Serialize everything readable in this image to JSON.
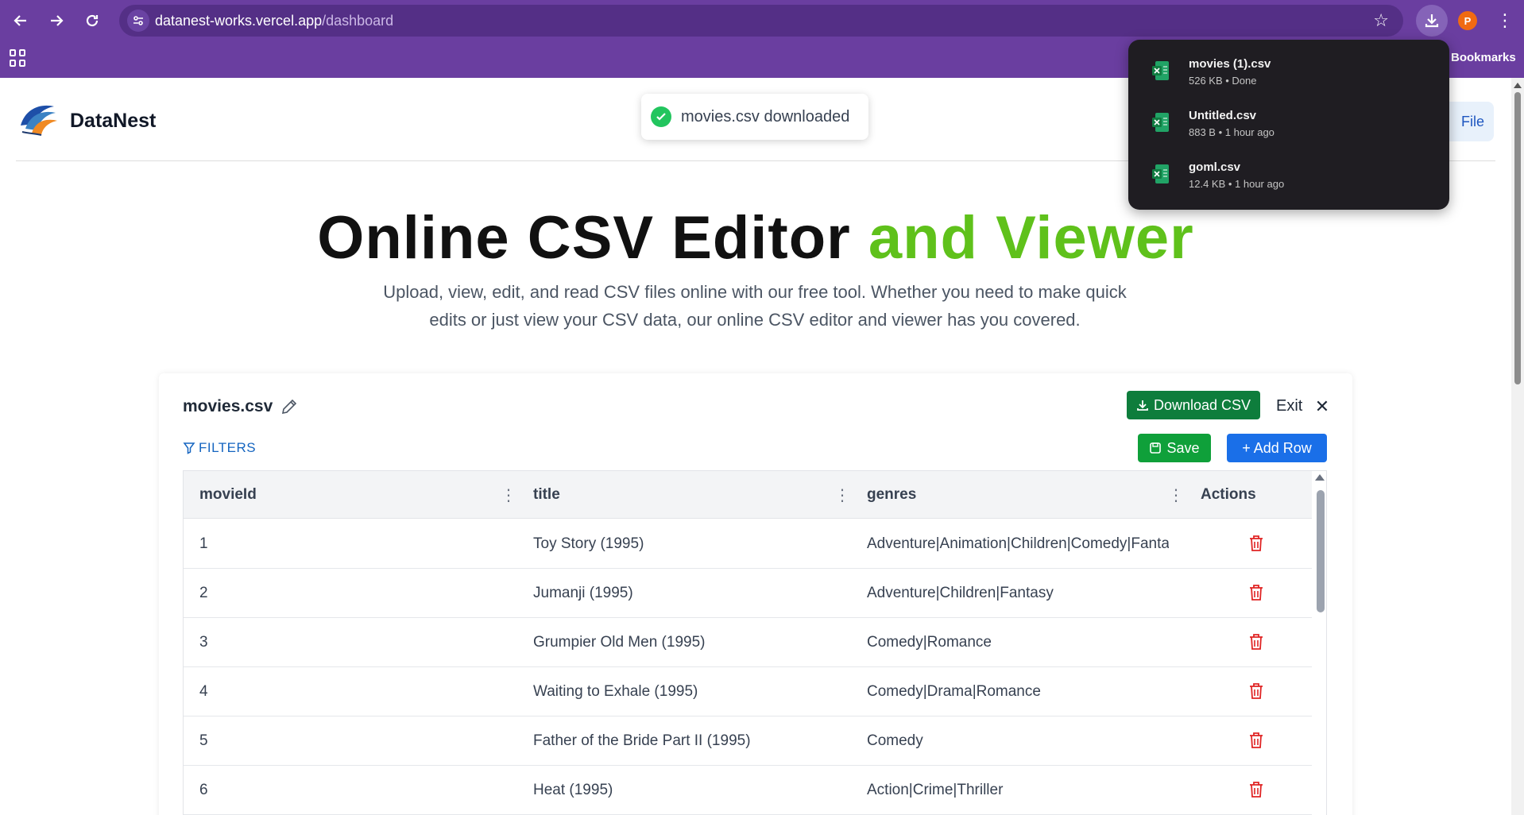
{
  "browser": {
    "url_host": "datanest-works.vercel.app",
    "url_path": "/dashboard",
    "bookmarks_label": "Bookmarks",
    "profile_initial": "P",
    "theme_color": "#6a3ea0"
  },
  "downloads": [
    {
      "name": "movies (1).csv",
      "meta": "526 KB • Done"
    },
    {
      "name": "Untitled.csv",
      "meta": "883 B • 1 hour ago"
    },
    {
      "name": "goml.csv",
      "meta": "12.4 KB • 1 hour ago"
    }
  ],
  "site": {
    "brand": "DataNest",
    "header_button_partial": "File"
  },
  "toast": {
    "message": "movies.csv downloaded",
    "color": "#22c55e"
  },
  "hero": {
    "title_main": "Online CSV Editor",
    "title_accent": "and Viewer",
    "accent_color": "#5fc11b",
    "subtitle": "Upload, view, edit, and read CSV files online with our free tool. Whether you need to make quick edits or just view your CSV data, our online CSV editor and viewer has you covered."
  },
  "editor": {
    "file_name": "movies.csv",
    "download_label": "Download CSV",
    "exit_label": "Exit",
    "filters_label": "FILTERS",
    "save_label": "Save",
    "add_row_label": "+ Add Row",
    "columns": [
      "movieId",
      "title",
      "genres",
      "Actions"
    ],
    "rows": [
      {
        "id": "1",
        "title": "Toy Story (1995)",
        "genres": "Adventure|Animation|Children|Comedy|Fantasy"
      },
      {
        "id": "2",
        "title": "Jumanji (1995)",
        "genres": "Adventure|Children|Fantasy"
      },
      {
        "id": "3",
        "title": "Grumpier Old Men (1995)",
        "genres": "Comedy|Romance"
      },
      {
        "id": "4",
        "title": "Waiting to Exhale (1995)",
        "genres": "Comedy|Drama|Romance"
      },
      {
        "id": "5",
        "title": "Father of the Bride Part II (1995)",
        "genres": "Comedy"
      },
      {
        "id": "6",
        "title": "Heat (1995)",
        "genres": "Action|Crime|Thriller"
      }
    ]
  }
}
